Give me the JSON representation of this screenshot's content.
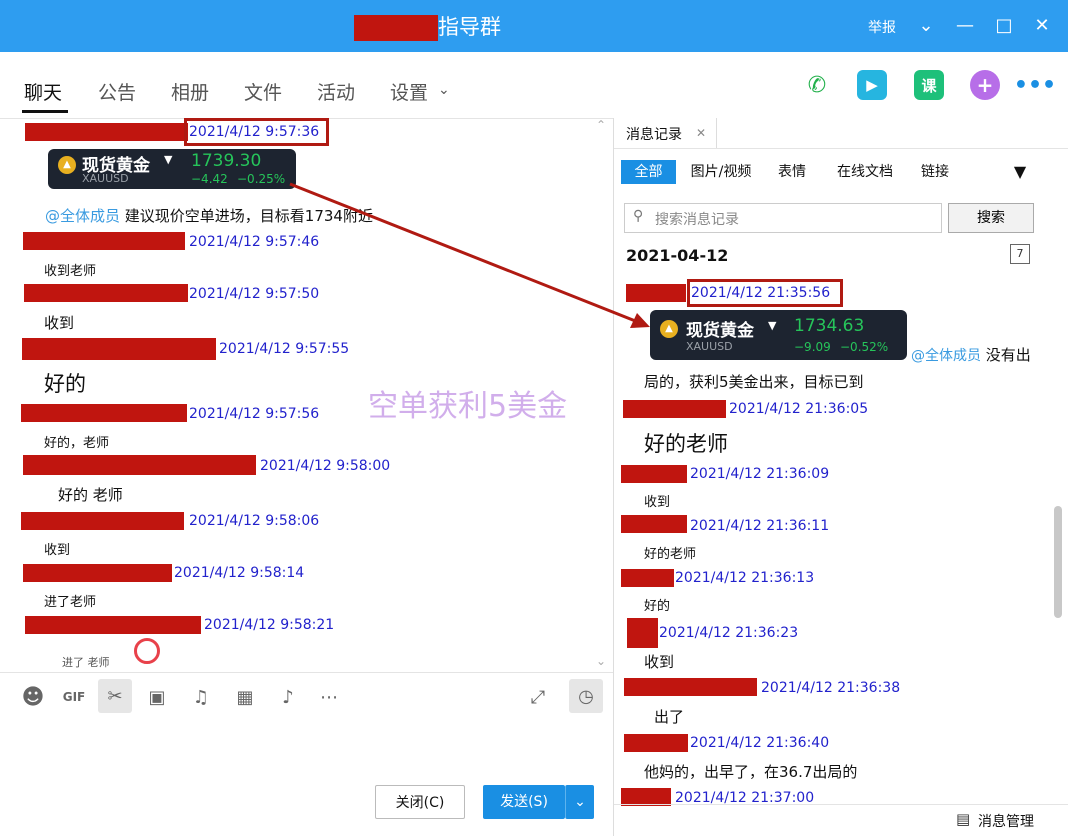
{
  "title": "指导群",
  "titlebar": {
    "report": "举报"
  },
  "tabs": [
    "聊天",
    "公告",
    "相册",
    "文件",
    "活动",
    "设置"
  ],
  "chat": {
    "card": {
      "name": "现货黄金",
      "symbol": "XAUUSD",
      "price": "1739.30",
      "change": "−4.42",
      "pct": "−0.25%"
    },
    "messages": [
      {
        "ts": "2021/4/12 9:57:36"
      },
      {
        "mention": "@全体成员",
        "text": "建议现价空单进场，目标看1734附近"
      },
      {
        "ts": "2021/4/12 9:57:46",
        "text": "收到老师"
      },
      {
        "ts": "2021/4/12 9:57:50",
        "text": "收到"
      },
      {
        "ts": "2021/4/12 9:57:55",
        "text": "好的"
      },
      {
        "ts": "2021/4/12 9:57:56",
        "text": "好的，老师"
      },
      {
        "ts": "2021/4/12 9:58:00",
        "text": "好的  老师"
      },
      {
        "ts": "2021/4/12 9:58:06",
        "text": "收到"
      },
      {
        "ts": "2021/4/12 9:58:14",
        "text": "进了老师"
      },
      {
        "ts": "2021/4/12 9:58:21",
        "text": "进了  老师"
      }
    ],
    "watermark": "空单获利5美金"
  },
  "buttons": {
    "close": "关闭(C)",
    "send": "发送(S)"
  },
  "history": {
    "tab": "消息记录",
    "filters": [
      "全部",
      "图片/视频",
      "表情",
      "在线文档",
      "链接"
    ],
    "search_placeholder": "搜索消息记录",
    "search_button": "搜索",
    "date": "2021-04-12",
    "card": {
      "name": "现货黄金",
      "symbol": "XAUUSD",
      "price": "1734.63",
      "change": "−9.09",
      "pct": "−0.52%"
    },
    "messages": [
      {
        "ts": "2021/4/12 21:35:56"
      },
      {
        "mention": "@全体成员",
        "text1": "没有出",
        "text2": "局的，获利5美金出来，目标已到"
      },
      {
        "ts": "2021/4/12 21:36:05",
        "text": "好的老师"
      },
      {
        "ts": "2021/4/12 21:36:09",
        "text": "收到"
      },
      {
        "ts": "2021/4/12 21:36:11",
        "text": "好的老师"
      },
      {
        "ts": "2021/4/12 21:36:13",
        "text": "好的"
      },
      {
        "ts": "2021/4/12 21:36:23",
        "text": "收到"
      },
      {
        "ts": "2021/4/12 21:36:38",
        "text": "出了"
      },
      {
        "ts": "2021/4/12 21:36:40",
        "text": "他妈的，出早了，在36.7出局的"
      },
      {
        "ts": "2021/4/12 21:37:00"
      }
    ],
    "manage": "消息管理"
  },
  "colors": {
    "titlebar": "#2e9df0",
    "redaction": "#c0150f",
    "timestamp": "#2222cc",
    "accent": "#1a8fe3"
  }
}
